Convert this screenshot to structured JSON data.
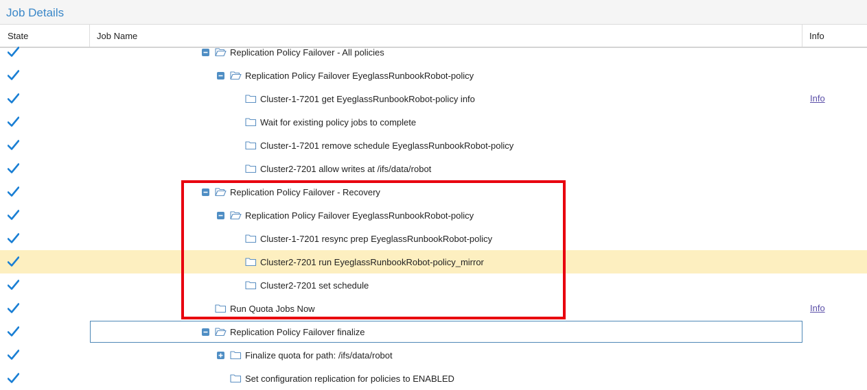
{
  "panel": {
    "title": "Job Details"
  },
  "columns": {
    "state": "State",
    "job_name": "Job Name",
    "info": "Info"
  },
  "colors": {
    "accent": "#3a87c8",
    "check": "#1a7fd4",
    "highlight": "#fdefc0",
    "annotation": "#e8000e"
  },
  "rows": [
    {
      "label": "Replication Policy Failover - All policies",
      "state": "complete",
      "toggle": "minus",
      "folder": "open",
      "depth": 0,
      "info": ""
    },
    {
      "label": "Replication Policy Failover EyeglassRunbookRobot-policy",
      "state": "complete",
      "toggle": "minus",
      "folder": "open",
      "depth": 1,
      "info": ""
    },
    {
      "label": "Cluster-1-7201 get EyeglassRunbookRobot-policy info",
      "state": "complete",
      "toggle": "none",
      "folder": "closed",
      "depth": 2,
      "info": "Info"
    },
    {
      "label": "Wait for existing policy jobs to complete",
      "state": "complete",
      "toggle": "none",
      "folder": "closed",
      "depth": 2,
      "info": ""
    },
    {
      "label": "Cluster-1-7201 remove schedule EyeglassRunbookRobot-policy",
      "state": "complete",
      "toggle": "none",
      "folder": "closed",
      "depth": 2,
      "info": ""
    },
    {
      "label": "Cluster2-7201 allow writes at /ifs/data/robot",
      "state": "complete",
      "toggle": "none",
      "folder": "closed",
      "depth": 2,
      "info": ""
    },
    {
      "label": "Replication Policy Failover - Recovery",
      "state": "complete",
      "toggle": "minus",
      "folder": "open",
      "depth": 0,
      "info": ""
    },
    {
      "label": "Replication Policy Failover EyeglassRunbookRobot-policy",
      "state": "complete",
      "toggle": "minus",
      "folder": "open",
      "depth": 1,
      "info": ""
    },
    {
      "label": "Cluster-1-7201 resync prep EyeglassRunbookRobot-policy",
      "state": "complete",
      "toggle": "none",
      "folder": "closed",
      "depth": 2,
      "info": ""
    },
    {
      "label": "Cluster2-7201 run EyeglassRunbookRobot-policy_mirror",
      "state": "complete",
      "toggle": "none",
      "folder": "closed",
      "depth": 2,
      "info": "",
      "highlighted": true
    },
    {
      "label": "Cluster2-7201 set schedule",
      "state": "complete",
      "toggle": "none",
      "folder": "closed",
      "depth": 2,
      "info": ""
    },
    {
      "label": "Run Quota Jobs Now",
      "state": "complete",
      "toggle": "none",
      "folder": "closed",
      "depth": 0,
      "info": "Info"
    },
    {
      "label": "Replication Policy Failover finalize",
      "state": "complete",
      "toggle": "minus",
      "folder": "open",
      "depth": 0,
      "info": "",
      "focused": true
    },
    {
      "label": "Finalize quota for path: /ifs/data/robot",
      "state": "complete",
      "toggle": "plus",
      "folder": "closed",
      "depth": 1,
      "info": ""
    },
    {
      "label": "Set configuration replication for policies to ENABLED",
      "state": "complete",
      "toggle": "none",
      "folder": "closed",
      "depth": 1,
      "info": ""
    }
  ]
}
